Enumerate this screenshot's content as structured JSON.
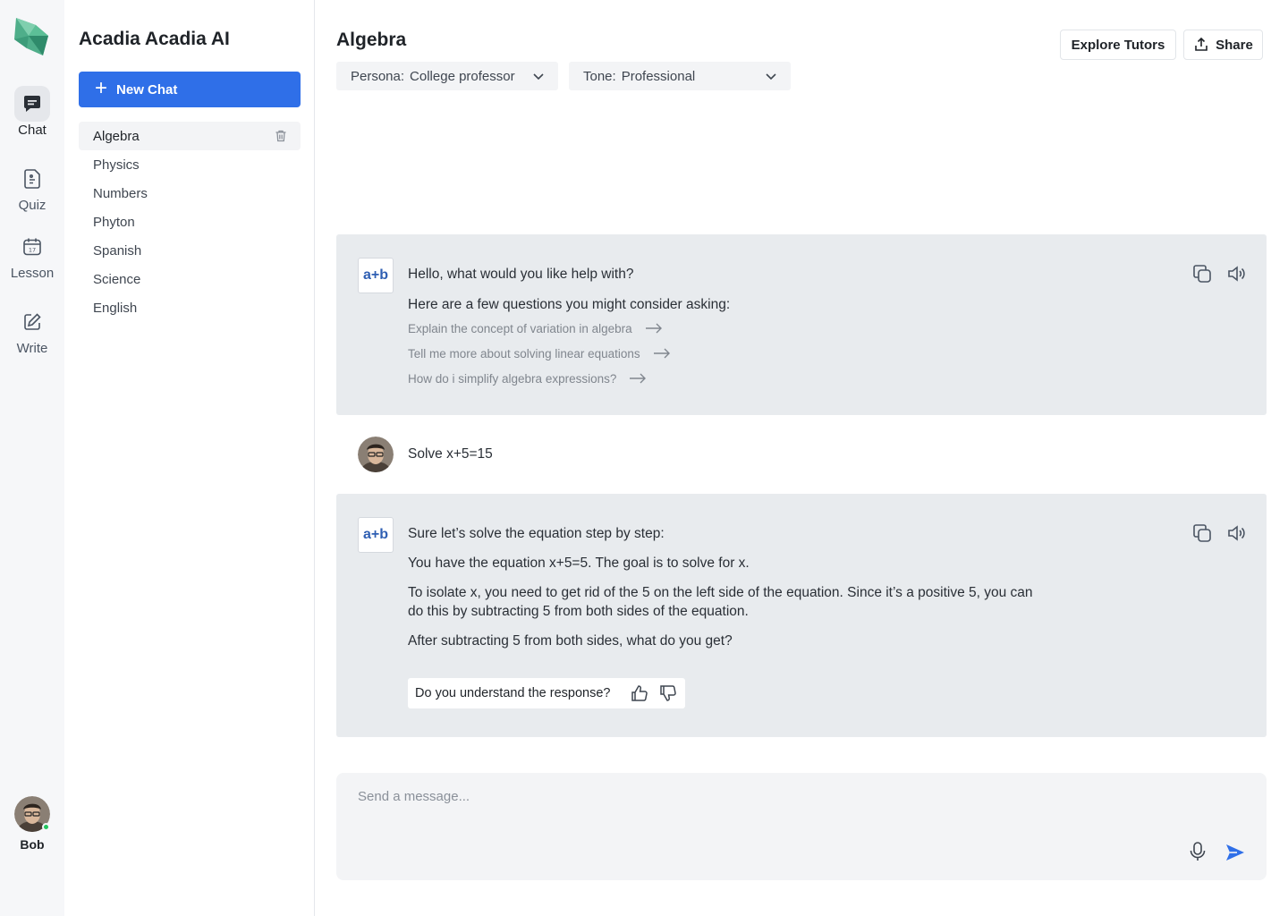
{
  "rail": {
    "logo_icon": "acadia-logo",
    "items": [
      {
        "label": "Chat",
        "icon": "chat-bubble-icon",
        "active": true
      },
      {
        "label": "Quiz",
        "icon": "quiz-document-icon",
        "active": false
      },
      {
        "label": "Lesson",
        "icon": "calendar-icon",
        "active": false
      },
      {
        "label": "Write",
        "icon": "edit-icon",
        "active": false
      }
    ],
    "user": {
      "name": "Bob",
      "status": "online"
    }
  },
  "sidebar": {
    "app_title": "Acadia Acadia AI",
    "new_chat_label": "New Chat",
    "chats": [
      {
        "label": "Algebra",
        "active": true
      },
      {
        "label": "Physics"
      },
      {
        "label": "Numbers"
      },
      {
        "label": "Phyton"
      },
      {
        "label": "Spanish"
      },
      {
        "label": "Science"
      },
      {
        "label": "English"
      }
    ]
  },
  "header": {
    "title": "Algebra",
    "explore_label": "Explore Tutors",
    "share_label": "Share",
    "persona": {
      "label": "Persona:",
      "value": "College professor"
    },
    "tone": {
      "label": "Tone:",
      "value": "Professional"
    }
  },
  "conversation": {
    "bot_avatar_text": "a+b",
    "greeting": {
      "text": "Hello, what would you like help with?",
      "suggest_intro": "Here are a few questions you might consider asking:",
      "suggestions": [
        "Explain the concept of variation in algebra",
        "Tell me more about solving linear equations",
        "How do i simplify algebra expressions?"
      ]
    },
    "user_message": "Solve x+5=15",
    "reply": {
      "paragraphs": [
        "Sure let’s solve the equation step by step:",
        "You have the equation x+5=5. The goal is to solve for x.",
        "To isolate x, you need to get rid of the 5 on the left side of the equation. Since it’s a positive 5, you can do this by subtracting 5 from both sides of the equation.",
        "After subtracting 5 from both sides, what do you get?"
      ],
      "feedback_question": "Do you understand the response?"
    }
  },
  "composer": {
    "placeholder": "Send a message...",
    "value": ""
  },
  "colors": {
    "accent": "#2f6fe8",
    "bot_bubble": "#e8ebee",
    "online": "#22c55e"
  }
}
